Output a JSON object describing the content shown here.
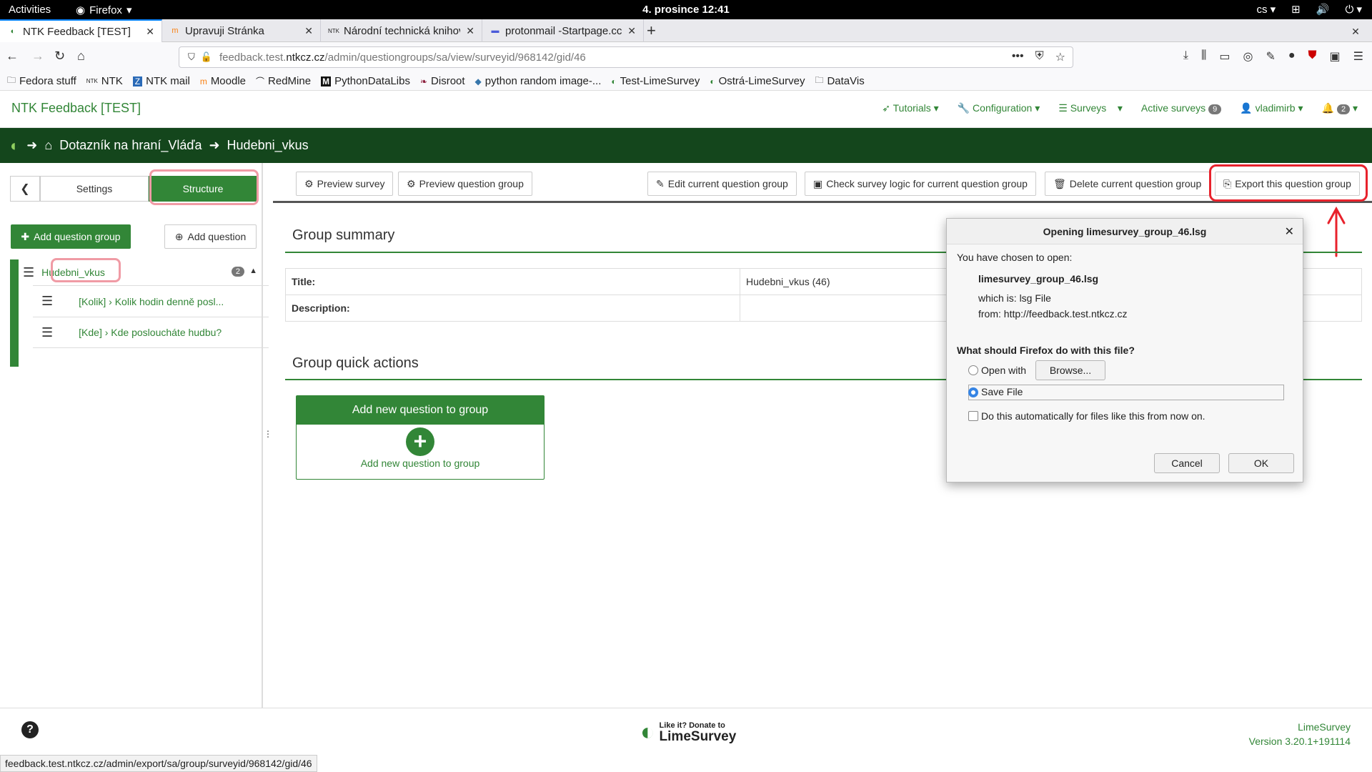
{
  "system": {
    "activities": "Activities",
    "app_name": "Firefox",
    "clock": "4. prosince  12:41",
    "lang": "cs"
  },
  "tabs": [
    {
      "title": "NTK Feedback [TEST]",
      "active": true
    },
    {
      "title": "Upravuji Stránka",
      "active": false
    },
    {
      "title": "Národní technická knihov",
      "active": false
    },
    {
      "title": "protonmail -Startpage.cc",
      "active": false
    }
  ],
  "urlbar": {
    "protocol_host_pre": "feedback.test.",
    "host": "ntkcz.cz",
    "path": "/admin/questiongroups/sa/view/surveyid/968142/gid/46"
  },
  "bookmarks": [
    {
      "label": "Fedora stuff",
      "icon": "folder-icon"
    },
    {
      "label": "NTK",
      "icon": "ntk-icon"
    },
    {
      "label": "NTK mail",
      "icon": "zimbra-icon"
    },
    {
      "label": "Moodle",
      "icon": "moodle-icon"
    },
    {
      "label": "RedMine",
      "icon": "redmine-icon"
    },
    {
      "label": "PythonDataLibs",
      "icon": "m-icon"
    },
    {
      "label": "Disroot",
      "icon": "disroot-icon"
    },
    {
      "label": "python random image-...",
      "icon": "python-icon"
    },
    {
      "label": "Test-LimeSurvey",
      "icon": "lime-icon"
    },
    {
      "label": "Ostrá-LimeSurvey",
      "icon": "lime-icon"
    },
    {
      "label": "DataVis",
      "icon": "folder-icon"
    }
  ],
  "header": {
    "brand": "NTK Feedback [TEST]",
    "menu": {
      "tutorials": "Tutorials",
      "configuration": "Configuration",
      "surveys": "Surveys",
      "active_surveys": "Active surveys",
      "active_count": "9",
      "user": "vladimirb",
      "notif_count": "2"
    }
  },
  "breadcrumb": {
    "survey": "Dotazník na hraní_Vláďa",
    "group": "Hudebni_vkus"
  },
  "sidebar": {
    "settings_tab": "Settings",
    "structure_tab": "Structure",
    "add_group": "Add question group",
    "add_question": "Add question",
    "group_name": "Hudebni_vkus",
    "group_count": "2",
    "questions": [
      {
        "code": "[Kolik]",
        "text": "Kolik hodin denně posl..."
      },
      {
        "code": "[Kde]",
        "text": "Kde posloucháte hudbu?"
      }
    ]
  },
  "toolbar": {
    "preview_survey": "Preview survey",
    "preview_group": "Preview question group",
    "edit_group": "Edit current question group",
    "check_logic": "Check survey logic for current question group",
    "delete_group": "Delete current question group",
    "export_group": "Export this question group"
  },
  "summary": {
    "title": "Group summary",
    "rows": [
      {
        "key": "Title:",
        "value": "Hudebni_vkus (46)"
      },
      {
        "key": "Description:",
        "value": ""
      }
    ]
  },
  "quick_actions": {
    "title": "Group quick actions",
    "card_title": "Add new question to group",
    "card_label": "Add new question to group"
  },
  "dialog": {
    "title": "Opening limesurvey_group_46.lsg",
    "chosen": "You have chosen to open:",
    "filename": "limesurvey_group_46.lsg",
    "which_is": "which is:  lsg File",
    "from": "from:  http://feedback.test.ntkcz.cz",
    "question": "What should Firefox do with this file?",
    "open_with": "Open with",
    "browse": "Browse...",
    "save_file": "Save File",
    "auto": "Do this automatically for files like this from now on.",
    "cancel": "Cancel",
    "ok": "OK"
  },
  "footer": {
    "donate_small": "Like it? Donate to",
    "donate_big": "LimeSurvey",
    "product": "LimeSurvey",
    "version": "Version 3.20.1+191114"
  },
  "statusbar": "feedback.test.ntkcz.cz/admin/export/sa/group/surveyid/968142/gid/46",
  "colors": {
    "brand_green": "#328637",
    "dark_green": "#14461c",
    "highlight_pink": "#f09ba5",
    "highlight_red": "#e8222c"
  }
}
